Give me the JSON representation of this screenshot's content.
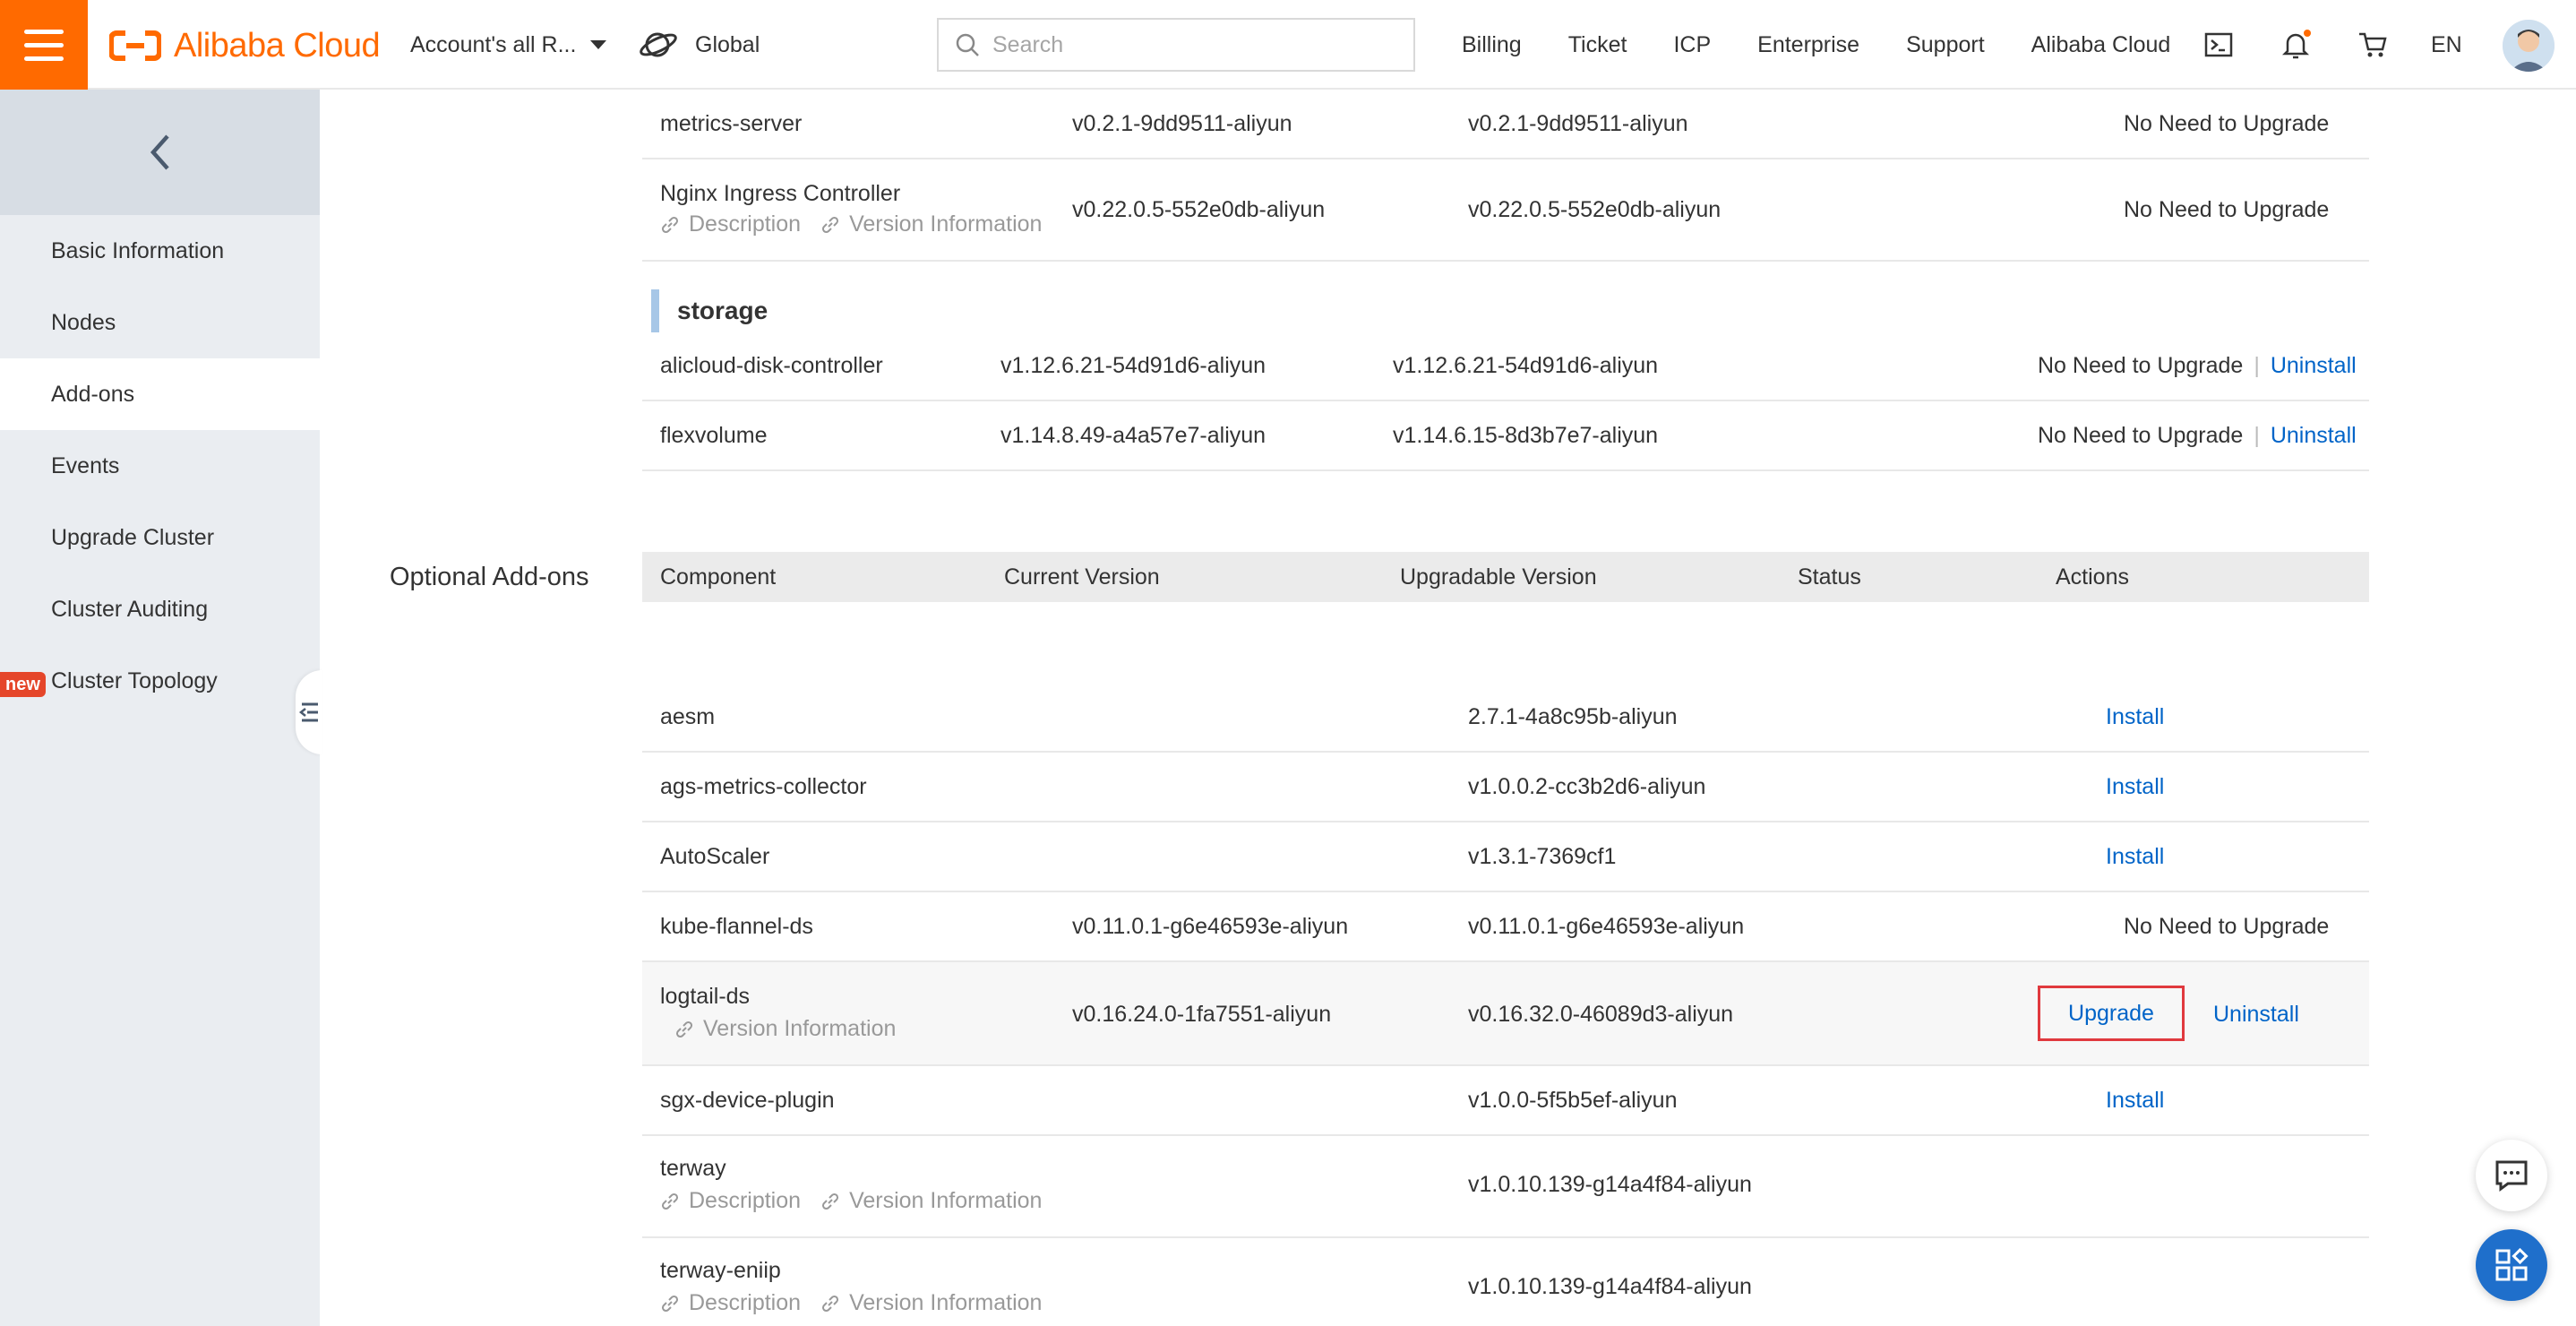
{
  "header": {
    "logo_text": "Alibaba Cloud",
    "account": "Account's all R...",
    "region": "Global",
    "search_placeholder": "Search",
    "nav": [
      "Billing",
      "Ticket",
      "ICP",
      "Enterprise",
      "Support",
      "Alibaba Cloud"
    ],
    "lang": "EN",
    "brand_color": "#ff6a00"
  },
  "sidebar": {
    "items": [
      {
        "label": "Basic Information"
      },
      {
        "label": "Nodes"
      },
      {
        "label": "Add-ons",
        "active": true
      },
      {
        "label": "Events"
      },
      {
        "label": "Upgrade Cluster"
      },
      {
        "label": "Cluster Auditing"
      },
      {
        "label": "Cluster Topology",
        "badge": "new"
      }
    ]
  },
  "links": {
    "description": "Description",
    "version_info": "Version Information",
    "install": "Install",
    "upgrade": "Upgrade",
    "uninstall": "Uninstall",
    "no_upgrade": "No Need to Upgrade"
  },
  "upper_rows": [
    {
      "name": "metrics-server",
      "current": "v0.2.1-9dd9511-aliyun",
      "upgradable": "v0.2.1-9dd9511-aliyun",
      "status": "No Need to Upgrade"
    },
    {
      "name": "Nginx Ingress Controller",
      "current": "v0.22.0.5-552e0db-aliyun",
      "upgradable": "v0.22.0.5-552e0db-aliyun",
      "status": "No Need to Upgrade",
      "links": [
        "Description",
        "Version Information"
      ]
    }
  ],
  "storage": {
    "title": "storage",
    "rows": [
      {
        "name": "alicloud-disk-controller",
        "current": "v1.12.6.21-54d91d6-aliyun",
        "upgradable": "v1.12.6.21-54d91d6-aliyun",
        "status": "No Need to Upgrade",
        "action": "Uninstall"
      },
      {
        "name": "flexvolume",
        "current": "v1.14.8.49-a4a57e7-aliyun",
        "upgradable": "v1.14.6.15-8d3b7e7-aliyun",
        "status": "No Need to Upgrade",
        "action": "Uninstall"
      }
    ]
  },
  "optional": {
    "title": "Optional Add-ons",
    "columns": [
      "Component",
      "Current Version",
      "Upgradable Version",
      "Status",
      "Actions"
    ],
    "rows": [
      {
        "name": "aesm",
        "current": "",
        "upgradable": "2.7.1-4a8c95b-aliyun",
        "action": "Install"
      },
      {
        "name": "ags-metrics-collector",
        "current": "",
        "upgradable": "v1.0.0.2-cc3b2d6-aliyun",
        "action": "Install"
      },
      {
        "name": "AutoScaler",
        "current": "",
        "upgradable": "v1.3.1-7369cf1",
        "action": "Install"
      },
      {
        "name": "kube-flannel-ds",
        "current": "v0.11.0.1-g6e46593e-aliyun",
        "upgradable": "v0.11.0.1-g6e46593e-aliyun",
        "action": "No Need to Upgrade"
      },
      {
        "name": "logtail-ds",
        "current": "v0.16.24.0-1fa7551-aliyun",
        "upgradable": "v0.16.32.0-46089d3-aliyun",
        "action": "Upgrade",
        "action2": "Uninstall",
        "links": [
          "Version Information"
        ],
        "highlighted": true
      },
      {
        "name": "sgx-device-plugin",
        "current": "",
        "upgradable": "v1.0.0-5f5b5ef-aliyun",
        "action": "Install"
      },
      {
        "name": "terway",
        "current": "",
        "upgradable": "v1.0.10.139-g14a4f84-aliyun",
        "action": "",
        "links": [
          "Description",
          "Version Information"
        ]
      },
      {
        "name": "terway-eniip",
        "current": "",
        "upgradable": "v1.0.10.139-g14a4f84-aliyun",
        "action": "",
        "links": [
          "Description",
          "Version Information"
        ]
      }
    ]
  }
}
